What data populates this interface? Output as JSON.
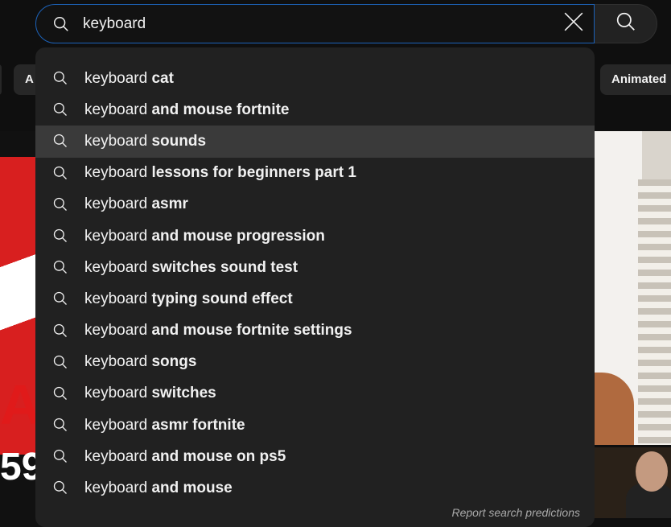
{
  "search": {
    "value": "keyboard",
    "query_prefix": "keyboard"
  },
  "chips": {
    "left_label": "A",
    "right_label": "Animated"
  },
  "background": {
    "left_thumb_text": "A",
    "left_thumb_number": "59"
  },
  "suggestions": [
    {
      "prefix": "keyboard",
      "completion": " cat"
    },
    {
      "prefix": "keyboard",
      "completion": " and mouse fortnite"
    },
    {
      "prefix": "keyboard",
      "completion": " sounds"
    },
    {
      "prefix": "keyboard",
      "completion": " lessons for beginners part 1"
    },
    {
      "prefix": "keyboard",
      "completion": " asmr"
    },
    {
      "prefix": "keyboard",
      "completion": " and mouse progression"
    },
    {
      "prefix": "keyboard",
      "completion": " switches sound test"
    },
    {
      "prefix": "keyboard",
      "completion": " typing sound effect"
    },
    {
      "prefix": "keyboard",
      "completion": " and mouse fortnite settings"
    },
    {
      "prefix": "keyboard",
      "completion": " songs"
    },
    {
      "prefix": "keyboard",
      "completion": " switches"
    },
    {
      "prefix": "keyboard",
      "completion": " asmr fortnite"
    },
    {
      "prefix": "keyboard",
      "completion": " and mouse on ps5"
    },
    {
      "prefix": "keyboard",
      "completion": " and mouse"
    }
  ],
  "hovered_index": 2,
  "report_label": "Report search predictions",
  "colors": {
    "background": "#0f0f0f",
    "dropdown": "#212121",
    "hover": "#3a3a3a",
    "focus_border": "#1c62b9",
    "text": "#f1f1f1",
    "muted": "#aaaaaa"
  }
}
